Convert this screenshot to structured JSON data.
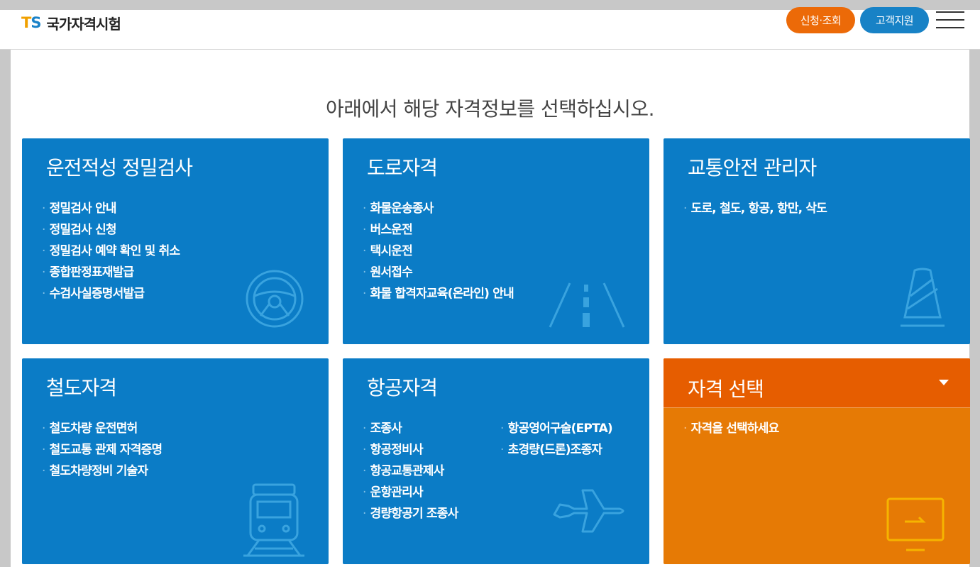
{
  "header": {
    "logo_mark_t": "T",
    "logo_mark_s": "S",
    "logo_text": "국가자격시험",
    "apply_label": "신청·조회",
    "support_label": "고객지원"
  },
  "main": {
    "heading": "아래에서 해당 자격정보를 선택하십시오."
  },
  "cards": {
    "c0": {
      "title": "운전적성 정밀검사",
      "items": [
        "정밀검사 안내",
        "정밀검사 신청",
        "정밀검사 예약 확인 및 취소",
        "종합판정표재발급",
        "수검사실증명서발급"
      ]
    },
    "c1": {
      "title": "도로자격",
      "items": [
        "화물운송종사",
        "버스운전",
        "택시운전",
        "원서접수",
        "화물 합격자교육(온라인) 안내"
      ]
    },
    "c2": {
      "title": "교통안전 관리자",
      "items": [
        "도로, 철도, 항공, 항만, 삭도"
      ]
    },
    "c3": {
      "title": "철도자격",
      "items": [
        "철도차량 운전면허",
        "철도교통 관제 자격증명",
        "철도차량정비 기술자"
      ]
    },
    "c4": {
      "title": "항공자격",
      "items": [
        "조종사",
        "항공정비사",
        "항공교통관제사",
        "운항관리사",
        "경량항공기 조종사"
      ],
      "items_right": [
        "항공영어구술(EPTA)",
        "초경량(드론)조종자"
      ]
    },
    "c5": {
      "title": "자격 선택",
      "items": [
        "자격을 선택하세요"
      ]
    }
  },
  "colors": {
    "card_blue": "#0b7cc6",
    "card_orange": "#e67a05",
    "accent_orange": "#ec6a08",
    "accent_blue": "#1882c6"
  },
  "icons": {
    "c0": "steering-wheel-icon",
    "c1": "road-icon",
    "c2": "traffic-cone-icon",
    "c3": "train-icon",
    "c4": "airplane-icon",
    "c5": "monitor-icon"
  }
}
